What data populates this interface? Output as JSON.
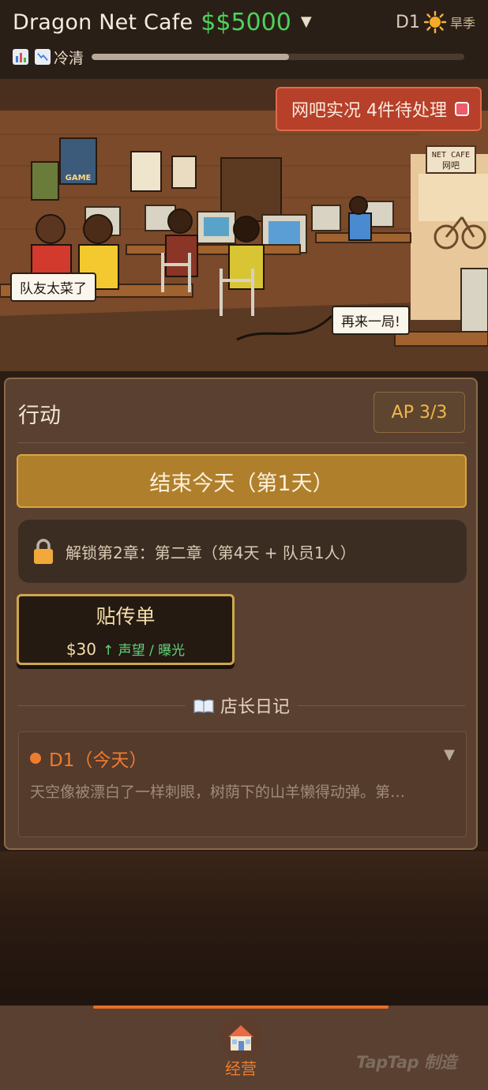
{
  "header": {
    "cafe_name": "Dragon Net Cafe",
    "money": "$$5000",
    "day": "D1",
    "season": "旱季",
    "mood_label": "冷清",
    "mood_level_percent": 53
  },
  "scene": {
    "live_label": "网吧实况 4件待处理",
    "bubble_left": "队友太菜了",
    "bubble_right": "再来一局!",
    "sign_line1": "NET CAFE",
    "sign_line2": "网吧",
    "poster_text": "GAME"
  },
  "actions": {
    "title": "行动",
    "ap": "AP 3/3",
    "end_day_label": "结束今天（第1天）",
    "unlock_text": "解锁第2章：第二章（第4天 + 队员1人）",
    "flyer": {
      "name": "贴传单",
      "cost": "$30",
      "effect": "↑ 声望 / 曝光"
    }
  },
  "diary": {
    "title": "店长日记",
    "day_label": "D1（今天）",
    "text": "天空像被漂白了一样刺眼，树荫下的山羊懒得动弹。第…"
  },
  "nav": {
    "tab_label": "经营",
    "brand": "TapTap 制造"
  },
  "colors": {
    "money_green": "#4cd35a",
    "accent_orange": "#ef7b2f",
    "end_day_gold": "#b07f2c",
    "live_red": "#b6402a"
  }
}
